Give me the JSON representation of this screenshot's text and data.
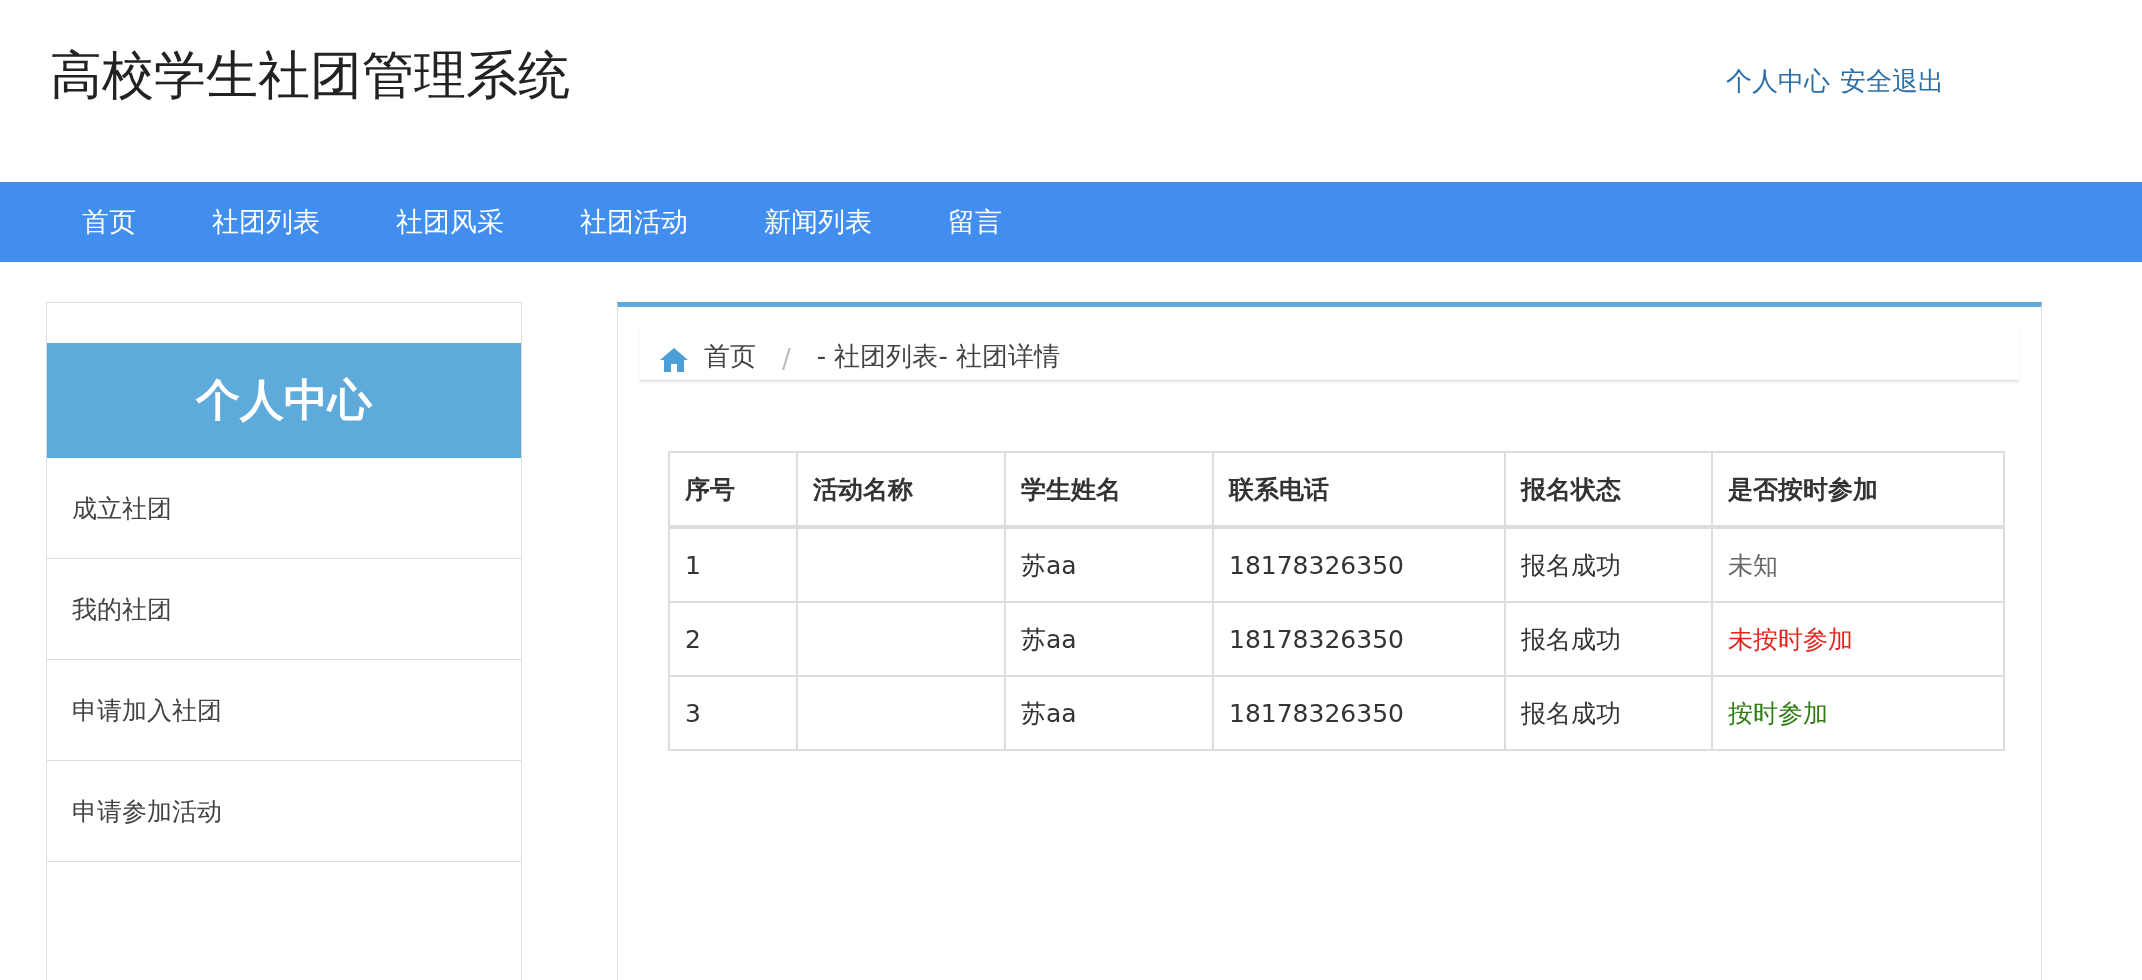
{
  "header": {
    "title": "高校学生社团管理系统",
    "links": [
      "个人中心",
      "安全退出"
    ]
  },
  "nav": [
    "首页",
    "社团列表",
    "社团风采",
    "社团活动",
    "新闻列表",
    "留言"
  ],
  "sidebar": {
    "title": "个人中心",
    "items": [
      "成立社团",
      "我的社团",
      "申请加入社团",
      "申请参加活动"
    ]
  },
  "breadcrumb": {
    "home": "首页",
    "separator": "/",
    "path": "- 社团列表- 社团详情"
  },
  "table": {
    "columns": [
      "序号",
      "活动名称",
      "学生姓名",
      "联系电话",
      "报名状态",
      "是否按时参加"
    ],
    "rows": [
      {
        "no": "1",
        "student": "苏aa",
        "phone": "18178326350",
        "status": "报名成功",
        "attendance": {
          "text": "未知",
          "color": "#666666"
        }
      },
      {
        "no": "2",
        "student": "苏aa",
        "phone": "18178326350",
        "status": "报名成功",
        "attendance": {
          "text": "未按时参加",
          "color": "#e0271e"
        }
      },
      {
        "no": "3",
        "student": "苏aa",
        "phone": "18178326350",
        "status": "报名成功",
        "attendance": {
          "text": "按时参加",
          "color": "#2e7d13"
        }
      }
    ]
  }
}
